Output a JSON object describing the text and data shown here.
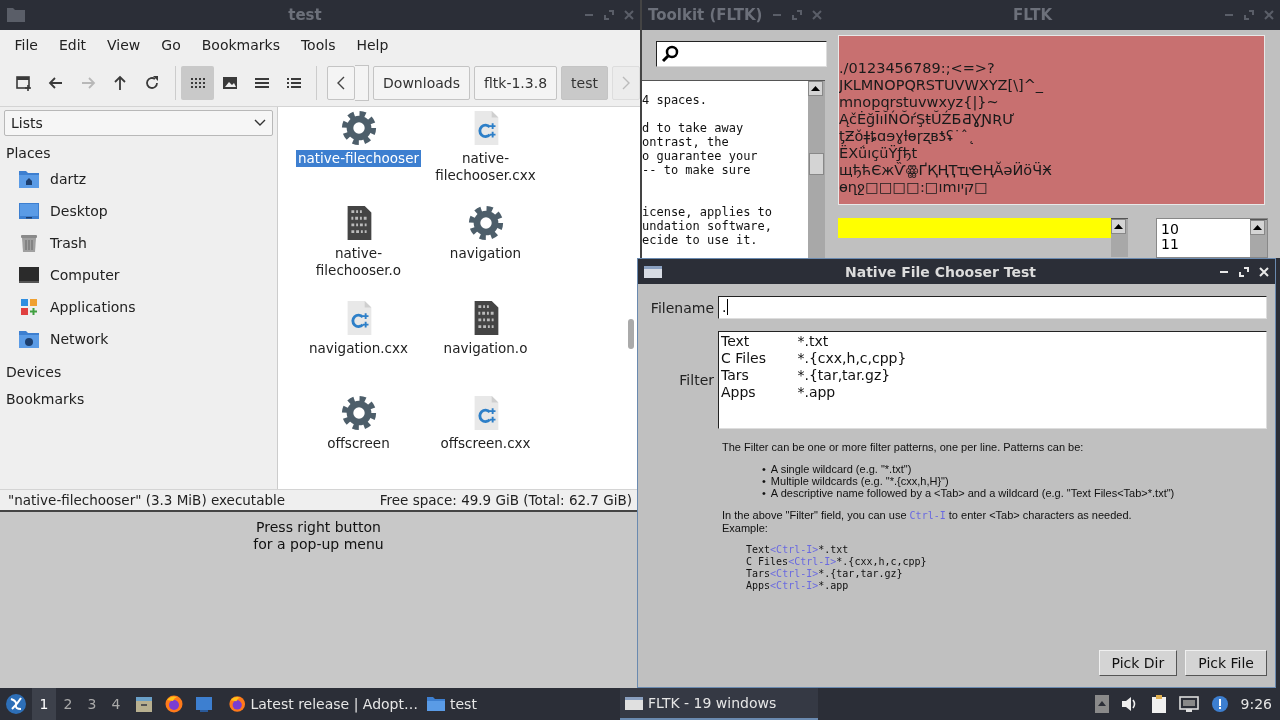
{
  "file_manager": {
    "title": "test",
    "active": false,
    "menu": [
      "File",
      "Edit",
      "View",
      "Go",
      "Bookmarks",
      "Tools",
      "Help"
    ],
    "toolbar": [
      {
        "kind": "new-window",
        "disabled": false,
        "selected": false
      },
      {
        "kind": "back",
        "disabled": false,
        "selected": false
      },
      {
        "kind": "forward",
        "disabled": true,
        "selected": false
      },
      {
        "kind": "up",
        "disabled": false,
        "selected": false
      },
      {
        "kind": "reload",
        "disabled": false,
        "selected": false
      },
      {
        "kind": "icon-view",
        "disabled": false,
        "selected": true
      },
      {
        "kind": "thumbnail-view",
        "disabled": false,
        "selected": false
      },
      {
        "kind": "compact-view",
        "disabled": false,
        "selected": false
      },
      {
        "kind": "detail-view",
        "disabled": false,
        "selected": false
      }
    ],
    "path_scroll": [
      {
        "kind": "back",
        "disabled": false
      },
      {
        "kind": "forward",
        "disabled": true
      }
    ],
    "path": [
      {
        "label": "Downloads",
        "selected": false
      },
      {
        "label": "fltk-1.3.8",
        "selected": false
      },
      {
        "label": "test",
        "selected": true
      }
    ],
    "side_pane": {
      "mode": "Lists",
      "sections": [
        {
          "label": "Places",
          "items": [
            {
              "label": "dartz",
              "kind": "home"
            },
            {
              "label": "Desktop",
              "kind": "desktop"
            },
            {
              "label": "Trash",
              "kind": "trash"
            },
            {
              "label": "Computer",
              "kind": "computer"
            },
            {
              "label": "Applications",
              "kind": "applications"
            },
            {
              "label": "Network",
              "kind": "network"
            }
          ]
        },
        {
          "label": "Devices"
        },
        {
          "label": "Bookmarks"
        }
      ]
    },
    "files": [
      {
        "name": "native-filechooser",
        "kind": "executable",
        "selected": true
      },
      {
        "name": "native-filechooser.cxx",
        "kind": "source",
        "selected": false
      },
      {
        "name": "native-filechooser.o",
        "kind": "object",
        "selected": false
      },
      {
        "name": "navigation",
        "kind": "executable",
        "selected": false
      },
      {
        "name": "navigation.cxx",
        "kind": "source",
        "selected": false
      },
      {
        "name": "navigation.o",
        "kind": "object",
        "selected": false
      },
      {
        "name": "offscreen",
        "kind": "executable",
        "selected": false
      },
      {
        "name": "offscreen.cxx",
        "kind": "source",
        "selected": false
      }
    ],
    "status": {
      "selection": "\"native-filechooser\" (3.3 MiB) executable",
      "free_space": "Free space: 49.9 GiB (Total: 62.7 GiB)"
    }
  },
  "popup_area": {
    "text": "Press right button\nfor a pop-up menu"
  },
  "toolkit_window": {
    "title": "Toolkit (FLTK)",
    "active": false,
    "paragraphs": [
      [
        "4 spaces."
      ],
      [
        "d to take away",
        "ontrast, the",
        "o guarantee your",
        "-- to make sure"
      ],
      [
        "icense, applies to",
        "undation software,",
        "ecide to use it."
      ]
    ]
  },
  "fltk_window": {
    "title": "FLTK",
    "active": false,
    "glyph_lines": [
      "./0123456789:;<=>?",
      "JKLMNOPQRSTUVWXYZ[\\]^_",
      "mnopqrstuvwxyz{|}~",
      "ĄčĖğĪıĬŃŎŕŞŧŬŹƂƋƔƝƦƯ",
      "ƫƵǒǂȶɑɘɣƚɵɼʐʙƾʢ˙ˆ˛",
      "ЁXǘıçüŸƒђt",
      "щђћЄжѶꙮҐҚҢҬҵҼҢӐәӤӧӴӾ",
      "ɵղջ□□□□:□ımקיו□"
    ],
    "list_items": [
      "10",
      "11"
    ]
  },
  "dialog": {
    "title": "Native File Chooser Test",
    "active": true,
    "filename": {
      "label": "Filename",
      "value": "."
    },
    "filter": {
      "label": "Filter",
      "lines": [
        {
          "name": "Text",
          "pattern": "*.txt"
        },
        {
          "name": "C Files",
          "pattern": "*.{cxx,h,c,cpp}"
        },
        {
          "name": "Tars",
          "pattern": "*.{tar,tar.gz}"
        },
        {
          "name": "Apps",
          "pattern": "*.app"
        }
      ]
    },
    "help": {
      "intro": "The Filter can be one or more filter patterns, one per line. Patterns can be:",
      "bullets": [
        {
          "marker": "•",
          "text": "A single wildcard (e.g.  \"*.txt\")"
        },
        {
          "marker": "•",
          "text": "Multiple wildcards (e.g.  \"*.{cxx,h,H}\")"
        },
        {
          "marker": "•",
          "text": "A descriptive name followed by a <Tab> and a wildcard (e.g.  \"Text Files<Tab>*.txt\")"
        }
      ],
      "note": {
        "before": "In the above \"Filter\" field, you can use",
        "key": "Ctrl-I",
        "after": "to enter <Tab> characters as needed."
      },
      "example_label": "Example:",
      "examples": [
        {
          "name": "Text",
          "key": "<Ctrl-I>",
          "pattern": "*.txt"
        },
        {
          "name": "C Files",
          "key": "<Ctrl-I>",
          "pattern": "*.{cxx,h,c,cpp}"
        },
        {
          "name": "Tars",
          "key": "<Ctrl-I>",
          "pattern": "*.{tar,tar.gz}"
        },
        {
          "name": "Apps",
          "key": "<Ctrl-I>",
          "pattern": "*.app"
        }
      ]
    },
    "buttons": [
      "Pick Dir",
      "Pick File"
    ]
  },
  "taskbar": {
    "workspaces": [
      {
        "label": "1",
        "selected": true
      },
      {
        "label": "2",
        "selected": false
      },
      {
        "label": "3",
        "selected": false
      },
      {
        "label": "4",
        "selected": false
      }
    ],
    "launchers": [
      {
        "kind": "files"
      },
      {
        "kind": "browser"
      },
      {
        "kind": "desktop"
      }
    ],
    "tasks": [
      {
        "label": "Latest release | Adopt…",
        "kind": "browser",
        "selected": false
      },
      {
        "label": "test",
        "kind": "folder",
        "selected": false
      },
      {
        "label": "FLTK - 19 windows",
        "kind": "window",
        "selected": true
      }
    ],
    "clock": "9:26"
  }
}
